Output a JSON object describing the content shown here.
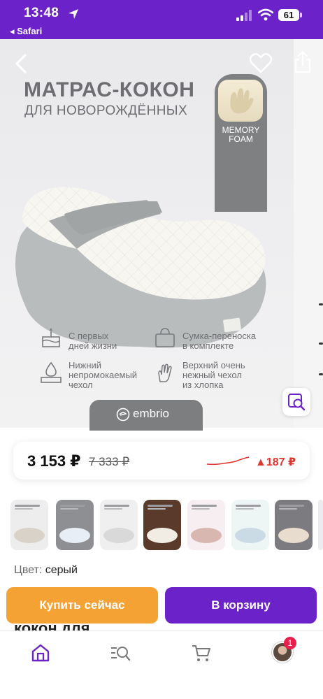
{
  "status_bar": {
    "time": "13:48",
    "back_app": "◂ Safari",
    "battery": "61"
  },
  "hero": {
    "title": "МАТРАС-КОКОН",
    "subtitle": "ДЛЯ НОВОРОЖДЁННЫХ",
    "memory_badge": [
      "MEMORY",
      "FOAM"
    ],
    "features": [
      {
        "icon": "cake-icon",
        "lines": [
          "С первых",
          "дней жизни"
        ]
      },
      {
        "icon": "bag-icon",
        "lines": [
          "Сумка-переноска",
          "в комплекте"
        ]
      },
      {
        "icon": "waterproof-icon",
        "lines": [
          "Нижний",
          "непромокаемый",
          "чехол"
        ]
      },
      {
        "icon": "hand-icon",
        "lines": [
          "Верхний очень",
          "нежный чехол",
          "из хлопка"
        ]
      }
    ],
    "brand": "embrio"
  },
  "price": {
    "current": "3 153 ₽",
    "old": "7 333 ₽",
    "change": "▲187 ₽",
    "change_color": "#e0342f"
  },
  "thumbnails": [
    {
      "bg": "#ededee",
      "body": "#d8d2c8"
    },
    {
      "bg": "#8e8f92",
      "body": "#e8eef6"
    },
    {
      "bg": "#efefef",
      "body": "#d9d9d9"
    },
    {
      "bg": "#5a3b2b",
      "body": "#f1ede4"
    },
    {
      "bg": "#f6eef0",
      "body": "#d7b7b0"
    },
    {
      "bg": "#eef5f5",
      "body": "#cbdbe6"
    },
    {
      "bg": "#7c7c80",
      "body": "#e8dccf"
    },
    {
      "bg": "#ececee",
      "body": "#d2d2d2"
    }
  ],
  "color": {
    "label": "Цвет:",
    "value": "серый"
  },
  "buttons": {
    "buy": "Купить сейчас",
    "cart": "В корзину"
  },
  "peek_title": "кокон для",
  "tabbar": {
    "profile_badge": "1"
  },
  "colors": {
    "brand_purple": "#6b22c9",
    "buy_orange": "#f4a233"
  }
}
